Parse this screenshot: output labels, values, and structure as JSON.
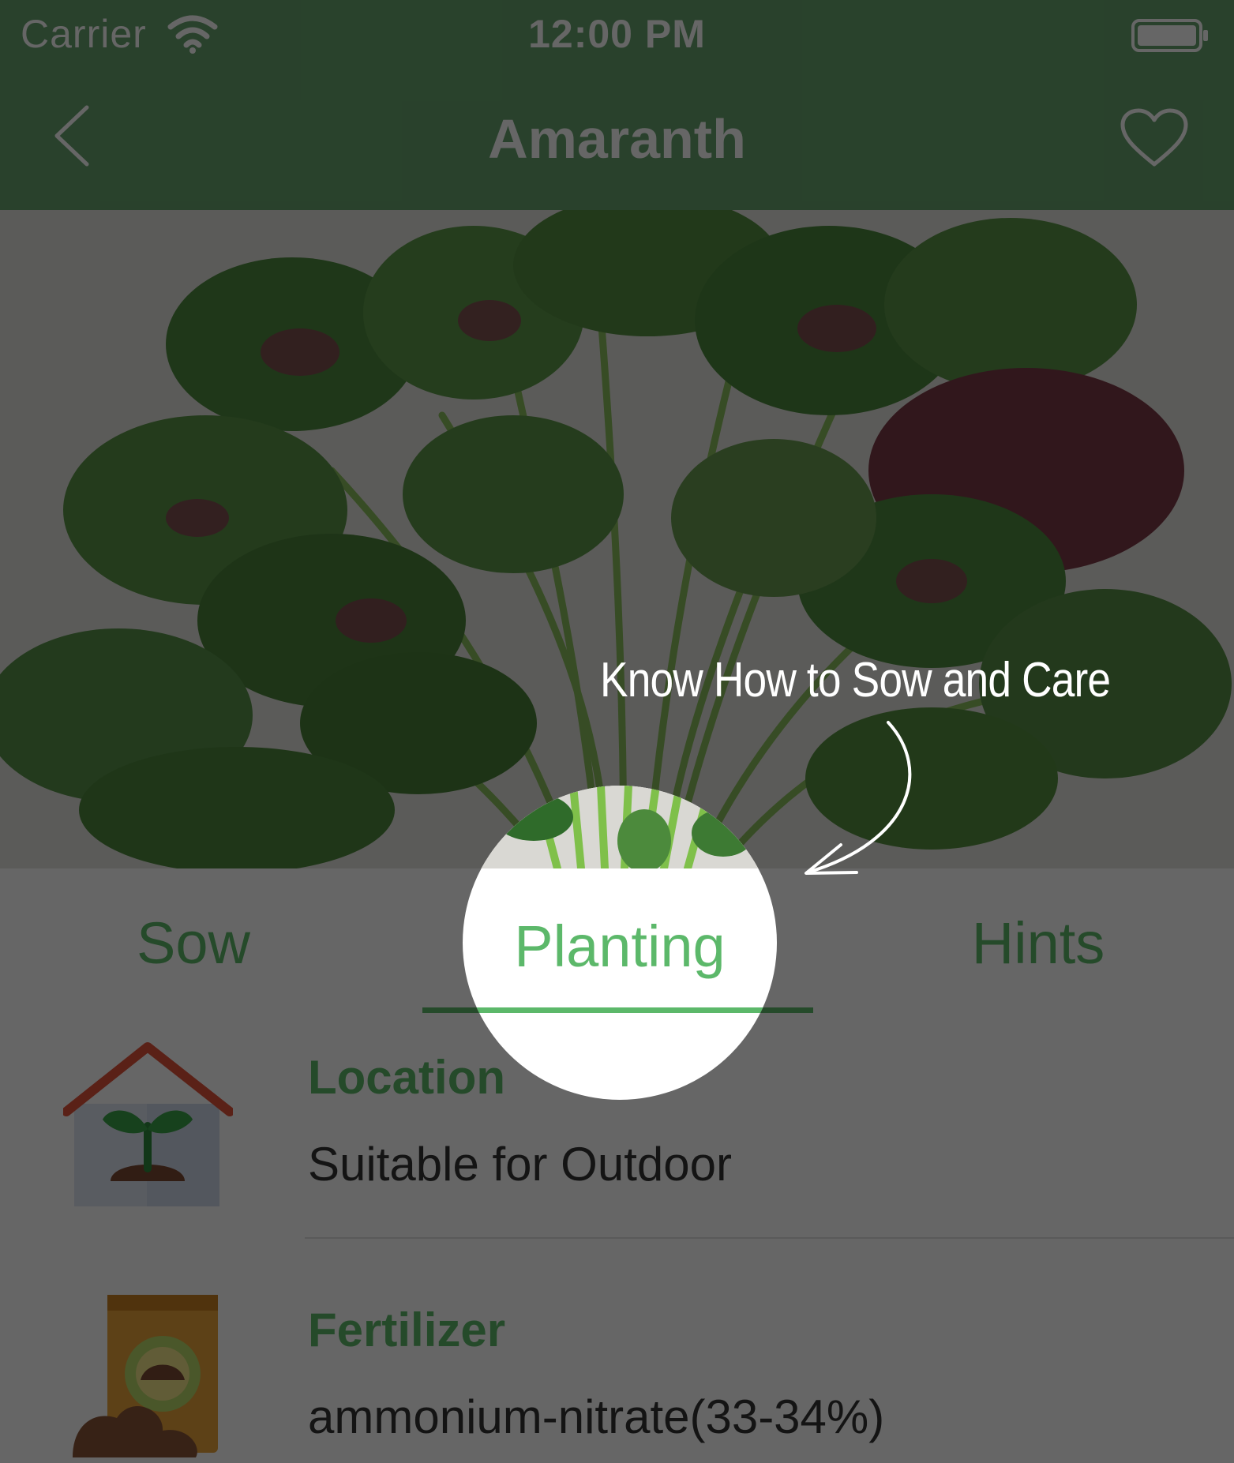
{
  "status_bar": {
    "carrier": "Carrier",
    "time": "12:00 PM"
  },
  "nav": {
    "title": "Amaranth",
    "back_icon": "chevron-left-icon",
    "favorite_icon": "heart-icon"
  },
  "photo": {
    "subject": "amaranth-leaves-photo"
  },
  "tabs": [
    {
      "label": "Sow",
      "selected": false
    },
    {
      "label": "Planting",
      "selected": true
    },
    {
      "label": "Hints",
      "selected": false
    }
  ],
  "details": [
    {
      "title": "Location",
      "value": "Suitable for Outdoor",
      "icon": "greenhouse-sprout-icon"
    },
    {
      "title": "Fertilizer",
      "value": "ammonium-nitrate(33-34%)",
      "icon": "fertilizer-bag-icon"
    }
  ],
  "tutorial": {
    "callout": "Know How to Sow and Care"
  },
  "colors": {
    "brand_green": "#67a46f",
    "accent_green": "#5cb86a",
    "overlay": "rgba(0,0,0,0.6)"
  }
}
